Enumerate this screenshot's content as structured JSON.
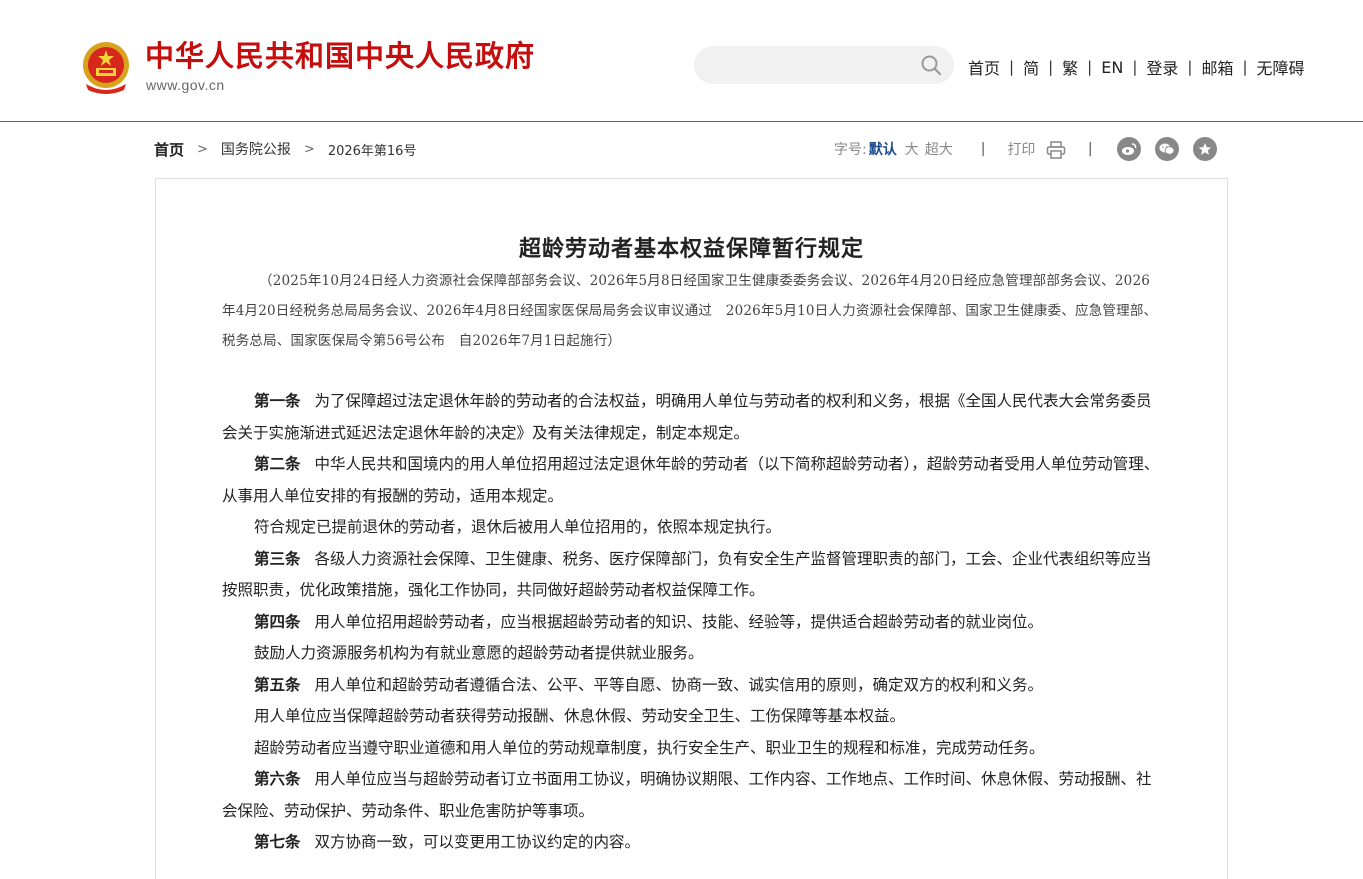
{
  "header": {
    "site_title": "中华人民共和国中央人民政府",
    "site_url": "www.gov.cn",
    "search_placeholder": "",
    "nav": [
      "首页",
      "简",
      "繁",
      "EN",
      "登录",
      "邮箱",
      "无障碍"
    ]
  },
  "breadcrumb": {
    "home": "首页",
    "section": "国务院公报",
    "current": "2026年第16号"
  },
  "tools": {
    "font_size_label": "字号:",
    "font_default": "默认",
    "font_large": "大",
    "font_xlarge": "超大",
    "print_label": "打印",
    "share_icons": [
      "weibo-icon",
      "wechat-icon",
      "favorite-star-icon"
    ]
  },
  "colors": {
    "title_red": "#c40e0e",
    "header_line": "#2f6fb0",
    "active_font_blue": "#1e4b8f"
  },
  "article": {
    "title": "超龄劳动者基本权益保障暂行规定",
    "subtitle": "（2025年10月24日经人力资源社会保障部部务会议、2026年5月8日经国家卫生健康委委务会议、2026年4月20日经应急管理部部务会议、2026年4月20日经税务总局局务会议、2026年4月8日经国家医保局局务会议审议通过　2026年5月10日人力资源社会保障部、国家卫生健康委、应急管理部、税务总局、国家医保局令第56号公布　自2026年7月1日起施行）",
    "paragraphs": [
      {
        "label": "第一条",
        "text": "为了保障超过法定退休年龄的劳动者的合法权益，明确用人单位与劳动者的权利和义务，根据《全国人民代表大会常务委员会关于实施渐进式延迟法定退休年龄的决定》及有关法律规定，制定本规定。"
      },
      {
        "label": "第二条",
        "text": "中华人民共和国境内的用人单位招用超过法定退休年龄的劳动者（以下简称超龄劳动者），超龄劳动者受用人单位劳动管理、从事用人单位安排的有报酬的劳动，适用本规定。"
      },
      {
        "label": "",
        "text": "符合规定已提前退休的劳动者，退休后被用人单位招用的，依照本规定执行。"
      },
      {
        "label": "第三条",
        "text": "各级人力资源社会保障、卫生健康、税务、医疗保障部门，负有安全生产监督管理职责的部门，工会、企业代表组织等应当按照职责，优化政策措施，强化工作协同，共同做好超龄劳动者权益保障工作。"
      },
      {
        "label": "第四条",
        "text": "用人单位招用超龄劳动者，应当根据超龄劳动者的知识、技能、经验等，提供适合超龄劳动者的就业岗位。"
      },
      {
        "label": "",
        "text": "鼓励人力资源服务机构为有就业意愿的超龄劳动者提供就业服务。"
      },
      {
        "label": "第五条",
        "text": "用人单位和超龄劳动者遵循合法、公平、平等自愿、协商一致、诚实信用的原则，确定双方的权利和义务。"
      },
      {
        "label": "",
        "text": "用人单位应当保障超龄劳动者获得劳动报酬、休息休假、劳动安全卫生、工伤保障等基本权益。"
      },
      {
        "label": "",
        "text": "超龄劳动者应当遵守职业道德和用人单位的劳动规章制度，执行安全生产、职业卫生的规程和标准，完成劳动任务。"
      },
      {
        "label": "第六条",
        "text": "用人单位应当与超龄劳动者订立书面用工协议，明确协议期限、工作内容、工作地点、工作时间、休息休假、劳动报酬、社会保险、劳动保护、劳动条件、职业危害防护等事项。"
      },
      {
        "label": "第七条",
        "text": "双方协商一致，可以变更用工协议约定的内容。"
      }
    ]
  }
}
